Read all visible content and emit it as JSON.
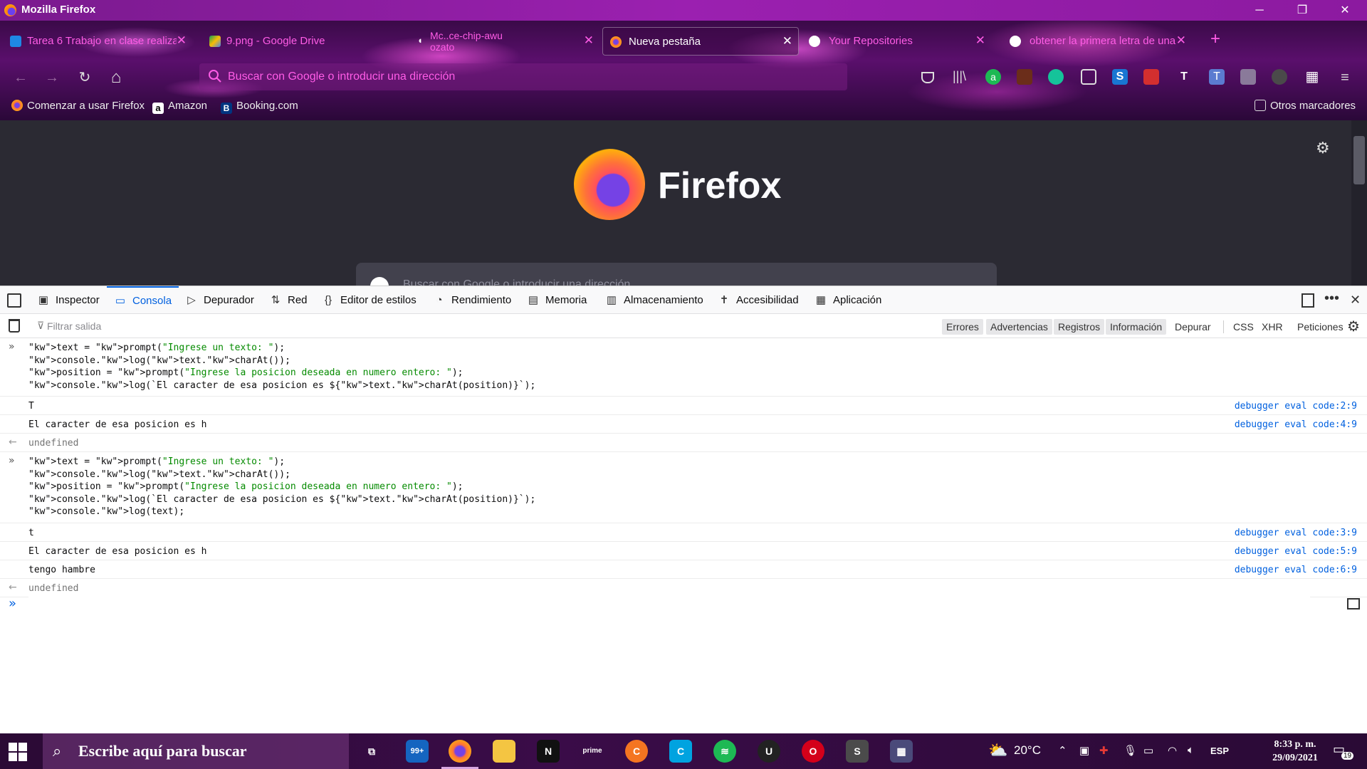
{
  "window": {
    "title": "Mozilla Firefox",
    "minimize": "─",
    "restore": "❐",
    "close": "✕"
  },
  "tabs": [
    {
      "label": "Tarea 6 Trabajo en clase realiza",
      "icon": "classroom-icon",
      "color": "#1e88e5"
    },
    {
      "label": "9.png - Google Drive",
      "icon": "google-drive-icon",
      "color": "#fbbc04"
    },
    {
      "label": "Mc..ce-chip-awu ozato",
      "icon": "speaker-icon",
      "color": "#ffffff"
    },
    {
      "label": "Nueva pestaña",
      "icon": "firefox-icon",
      "color": "#ff7139",
      "active": true
    },
    {
      "label": "Your Repositories",
      "icon": "github-icon",
      "color": "#ffffff"
    },
    {
      "label": "obtener la primera letra de una",
      "icon": "google-icon",
      "color": "#ffffff"
    }
  ],
  "new_tab": "+",
  "nav": {
    "back": "←",
    "forward": "→",
    "reload": "↻",
    "home": "⌂",
    "url_placeholder": "Buscar con Google o introducir una dirección",
    "menu": "≡"
  },
  "bookmarks": [
    {
      "label": "Comenzar a usar Firefox",
      "icon": "firefox-icon",
      "color": "#ff7139"
    },
    {
      "label": "Amazon",
      "icon": "amazon-icon",
      "color": "#ffffff"
    },
    {
      "label": "Booking.com",
      "icon": "booking-icon",
      "color": "#003580"
    }
  ],
  "other_bookmarks": "Otros marcadores",
  "newtab_page": {
    "brand": "Firefox",
    "search_placeholder": "Buscar con Google o introducir una dirección"
  },
  "devtools": {
    "tabs": [
      {
        "label": "Inspector",
        "icon": "inspector-icon",
        "glyph": "▣"
      },
      {
        "label": "Consola",
        "icon": "console-icon",
        "glyph": "▭",
        "active": true
      },
      {
        "label": "Depurador",
        "icon": "debugger-icon",
        "glyph": "▷"
      },
      {
        "label": "Red",
        "icon": "network-icon",
        "glyph": "⇅"
      },
      {
        "label": "Editor de estilos",
        "icon": "style-editor-icon",
        "glyph": "{}"
      },
      {
        "label": "Rendimiento",
        "icon": "performance-icon",
        "glyph": "◔"
      },
      {
        "label": "Memoria",
        "icon": "memory-icon",
        "glyph": "▤"
      },
      {
        "label": "Almacenamiento",
        "icon": "storage-icon",
        "glyph": "▥"
      },
      {
        "label": "Accesibilidad",
        "icon": "accessibility-icon",
        "glyph": "✝"
      },
      {
        "label": "Aplicación",
        "icon": "application-icon",
        "glyph": "▦"
      }
    ],
    "filter_placeholder": "Filtrar salida",
    "filters": [
      {
        "label": "Errores",
        "on": true
      },
      {
        "label": "Advertencias",
        "on": true
      },
      {
        "label": "Registros",
        "on": true
      },
      {
        "label": "Información",
        "on": true
      },
      {
        "label": "Depurar",
        "on": false
      },
      {
        "label": "CSS",
        "on": false
      },
      {
        "label": "XHR",
        "on": false
      },
      {
        "label": "Peticiones",
        "on": false
      }
    ]
  },
  "console": {
    "entries": [
      {
        "type": "input",
        "lines": [
          "text = prompt(\"Ingrese un texto: \");",
          "console.log(text.charAt());",
          "position = prompt(\"Ingrese la posicion deseada en numero entero: \");",
          "console.log(`El caracter de esa posicion es ${text.charAt(position)}`);"
        ]
      },
      {
        "type": "log",
        "text": "T",
        "location": "debugger eval code:2:9"
      },
      {
        "type": "log",
        "text": "El caracter de esa posicion es h",
        "location": "debugger eval code:4:9"
      },
      {
        "type": "result",
        "text": "undefined"
      },
      {
        "type": "input",
        "lines": [
          "text = prompt(\"Ingrese un texto: \");",
          "console.log(text.charAt());",
          "position = prompt(\"Ingrese la posicion deseada en numero entero: \");",
          "console.log(`El caracter de esa posicion es ${text.charAt(position)}`);",
          "console.log(text);"
        ]
      },
      {
        "type": "log",
        "text": "t",
        "location": "debugger eval code:3:9"
      },
      {
        "type": "log",
        "text": "El caracter de esa posicion es h",
        "location": "debugger eval code:5:9"
      },
      {
        "type": "log",
        "text": "tengo hambre",
        "location": "debugger eval code:6:9"
      },
      {
        "type": "result",
        "text": "undefined"
      }
    ],
    "prompt_symbol": "»"
  },
  "taskbar": {
    "search_placeholder": "Escribe aquí para buscar",
    "apps": [
      {
        "name": "task-view-icon",
        "label": "⧉",
        "color": "transparent"
      },
      {
        "name": "mail-icon",
        "label": "99+",
        "color": "#1565c0"
      },
      {
        "name": "firefox-icon",
        "label": "",
        "color": "#ff7139",
        "running": true
      },
      {
        "name": "file-explorer-icon",
        "label": "",
        "color": "#f4c542"
      },
      {
        "name": "netflix-icon",
        "label": "N",
        "color": "#111111"
      },
      {
        "name": "prime-video-icon",
        "label": "prime",
        "color": "transparent"
      },
      {
        "name": "crunchyroll-icon",
        "label": "C",
        "color": "#f47521"
      },
      {
        "name": "canva-icon",
        "label": "C",
        "color": "#00a3e0"
      },
      {
        "name": "spotify-icon",
        "label": "≋",
        "color": "#1db954"
      },
      {
        "name": "unreal-icon",
        "label": "U",
        "color": "#222222"
      },
      {
        "name": "opera-icon",
        "label": "O",
        "color": "#d4001a"
      },
      {
        "name": "sublime-icon",
        "label": "S",
        "color": "#4b4b4b"
      },
      {
        "name": "calculator-icon",
        "label": "▦",
        "color": "#4a4a7a"
      }
    ],
    "weather": "20°C",
    "language": "ESP",
    "time": "8:33 p. m.",
    "date": "29/09/2021",
    "notifications": "19"
  }
}
